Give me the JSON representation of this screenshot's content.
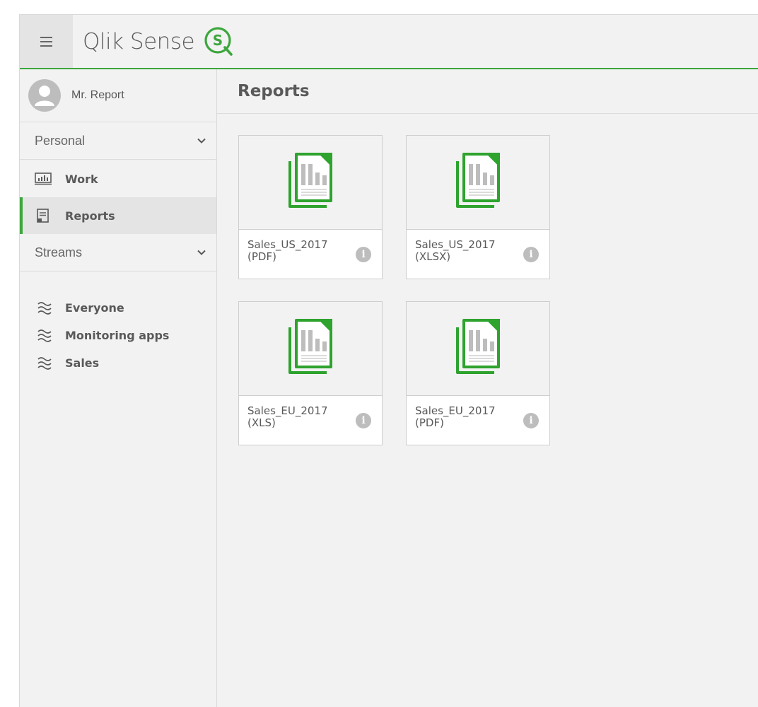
{
  "header": {
    "menu_icon": "hamburger-icon",
    "brand_name": "Qlik Sense",
    "brand_logo_letter": "S",
    "accent": "#3da63d"
  },
  "sidebar": {
    "user": {
      "name": "Mr. Report",
      "icon": "user-avatar-icon"
    },
    "personal": {
      "label": "Personal",
      "items": [
        {
          "label": "Work",
          "icon": "work-chart-icon",
          "active": false
        },
        {
          "label": "Reports",
          "icon": "report-doc-icon",
          "active": true
        }
      ]
    },
    "streams": {
      "label": "Streams",
      "items": [
        {
          "label": "Everyone",
          "icon": "stream-waves-icon"
        },
        {
          "label": "Monitoring apps",
          "icon": "stream-waves-icon"
        },
        {
          "label": "Sales",
          "icon": "stream-waves-icon"
        }
      ]
    }
  },
  "main": {
    "title": "Reports",
    "cards": [
      {
        "name": "Sales_US_2017",
        "format": "(PDF)"
      },
      {
        "name": "Sales_US_2017",
        "format": "(XLSX)"
      },
      {
        "name": "Sales_EU_2017",
        "format": "(XLS)"
      },
      {
        "name": "Sales_EU_2017",
        "format": "(PDF)"
      }
    ],
    "card_icon": "report-file-icon",
    "info_icon_glyph": "i"
  }
}
